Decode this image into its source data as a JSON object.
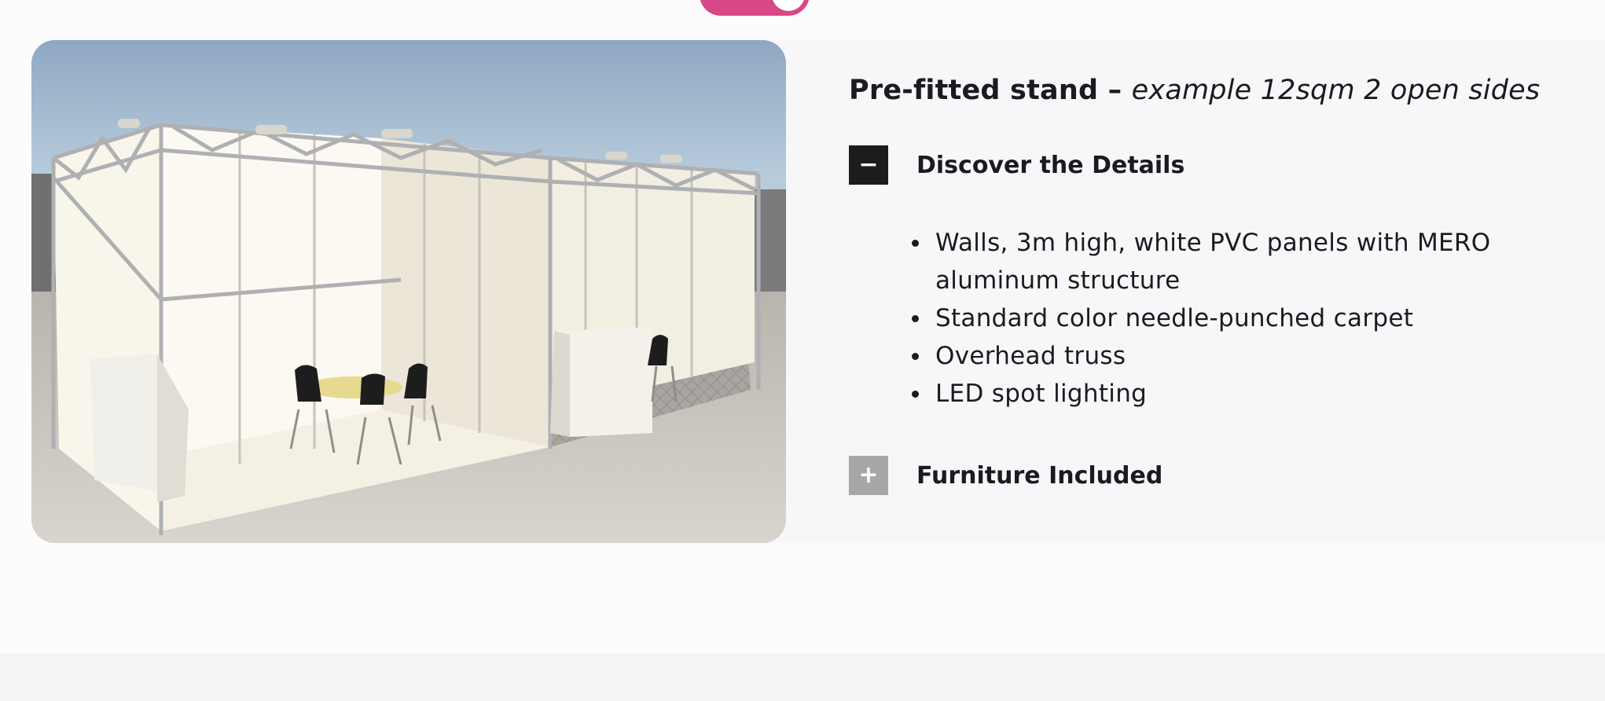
{
  "stand": {
    "title_strong": "Pre-fitted stand –",
    "title_muted": "example 12sqm 2 open sides",
    "image_alt": "Pre-fitted exhibition stand render with two open sides, white wall panels, overhead truss, counters and table with chairs"
  },
  "accordion": {
    "details": {
      "label": "Discover the Details",
      "toggle": "−",
      "expanded": true,
      "icon": "minus-icon",
      "items": [
        "Walls, 3m high, white PVC panels with MERO aluminum structure",
        "Standard color needle-punched carpet",
        "Overhead truss",
        "LED spot lighting"
      ]
    },
    "furniture": {
      "label": "Furniture Included",
      "toggle": "+",
      "expanded": false,
      "icon": "plus-icon"
    }
  },
  "colors": {
    "accent_pink": "#d94787",
    "toggle_open": "#1c1c1e",
    "toggle_closed": "#a7a7aa",
    "card_bg": "#f7f7f9"
  }
}
